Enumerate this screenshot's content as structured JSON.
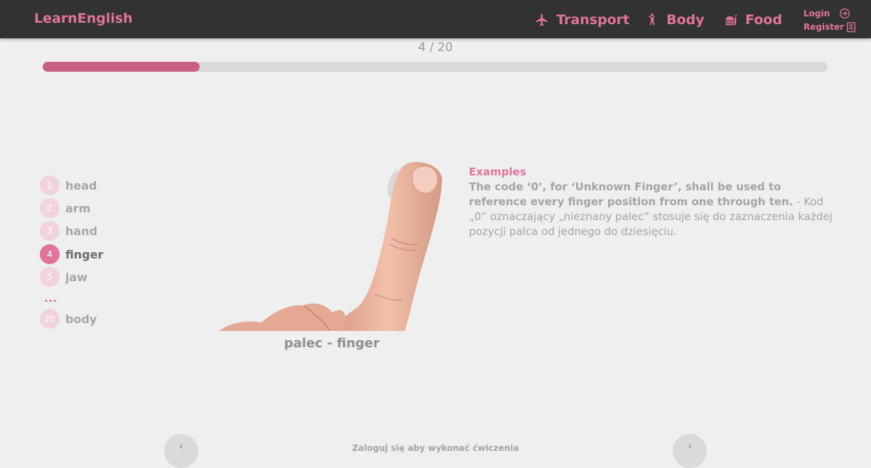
{
  "nav": {
    "brand": "LearnEnglish",
    "links": [
      {
        "label": "Transport",
        "icon": "airplane-icon"
      },
      {
        "label": "Body",
        "icon": "person-icon"
      },
      {
        "label": "Food",
        "icon": "food-icon"
      }
    ],
    "login": "Login",
    "register": "Register"
  },
  "progress": {
    "text": "4 / 20",
    "current": 4,
    "total": 20
  },
  "words": [
    {
      "num": "1",
      "label": "head"
    },
    {
      "num": "2",
      "label": "arm"
    },
    {
      "num": "3",
      "label": "hand"
    },
    {
      "num": "4",
      "label": "finger"
    },
    {
      "num": "5",
      "label": "jaw"
    },
    {
      "num": "20",
      "label": "body"
    }
  ],
  "ellipsis": "...",
  "caption": "palec - finger",
  "examples": {
    "title": "Examples",
    "sentence": "The code ‘0’, for ‘Unknown Finger’, shall be used to reference every finger position from one through ten.",
    "translation": " - Kod „0” oznaczający „nieznany palec” stosuje się do zaznaczenia każdej pozycji palca od jednego do dziesięciu."
  },
  "footer": {
    "prev": "‹",
    "next": "›",
    "message": "Zaloguj się aby wykonać ćwiczenia"
  },
  "colors": {
    "accent": "#e0749b",
    "progress": "#c96084",
    "navbar": "#323232"
  }
}
